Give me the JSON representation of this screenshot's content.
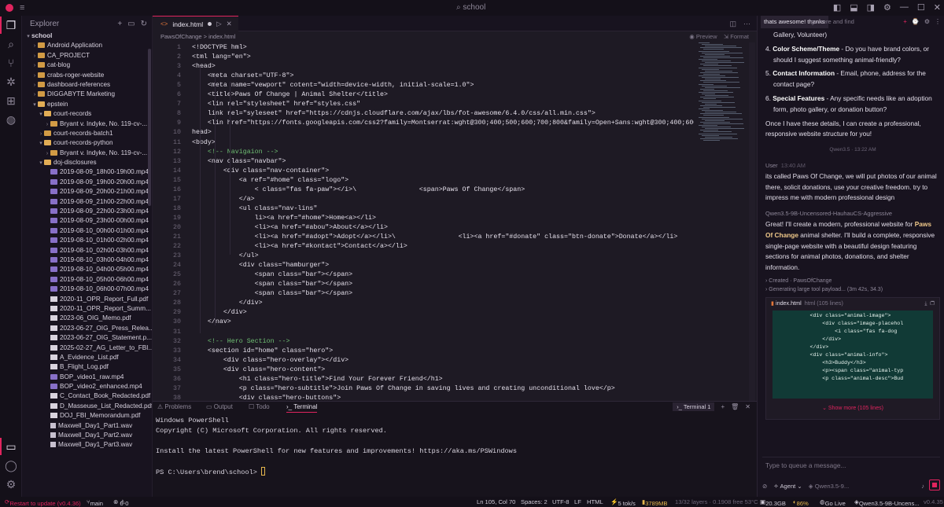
{
  "titlebar": {
    "search": "school"
  },
  "explorer": {
    "title": "Explorer",
    "root": "school",
    "items": [
      {
        "label": "Android Application",
        "kind": "folder",
        "depth": 1
      },
      {
        "label": "CA_PROJECT",
        "kind": "folder",
        "depth": 1
      },
      {
        "label": "cat-blog",
        "kind": "folder",
        "depth": 1
      },
      {
        "label": "crabs-roger-website",
        "kind": "folder",
        "depth": 1
      },
      {
        "label": "dashboard-references",
        "kind": "folder",
        "depth": 1
      },
      {
        "label": "DIGGABYTE Marketing",
        "kind": "folder",
        "depth": 1
      },
      {
        "label": "epstein",
        "kind": "folder-open",
        "depth": 1
      },
      {
        "label": "court-records",
        "kind": "folder-open",
        "depth": 2
      },
      {
        "label": "Bryant v. Indyke, No. 119-cv-...",
        "kind": "folder",
        "depth": 3
      },
      {
        "label": "court-records-batch1",
        "kind": "folder",
        "depth": 2
      },
      {
        "label": "court-records-python",
        "kind": "folder-open",
        "depth": 2
      },
      {
        "label": "Bryant v. Indyke, No. 119-cv-...",
        "kind": "folder",
        "depth": 3
      },
      {
        "label": "doj-disclosures",
        "kind": "folder-open",
        "depth": 2
      },
      {
        "label": "2019-08-09_18h00-19h00.mp4",
        "kind": "video",
        "depth": 3
      },
      {
        "label": "2019-08-09_19h00-20h00.mp4",
        "kind": "video",
        "depth": 3
      },
      {
        "label": "2019-08-09_20h00-21h00.mp4",
        "kind": "video",
        "depth": 3
      },
      {
        "label": "2019-08-09_21h00-22h00.mp4",
        "kind": "video",
        "depth": 3
      },
      {
        "label": "2019-08-09_22h00-23h00.mp4",
        "kind": "video",
        "depth": 3
      },
      {
        "label": "2019-08-09_23h00-00h00.mp4",
        "kind": "video",
        "depth": 3
      },
      {
        "label": "2019-08-10_00h00-01h00.mp4",
        "kind": "video",
        "depth": 3
      },
      {
        "label": "2019-08-10_01h00-02h00.mp4",
        "kind": "video",
        "depth": 3
      },
      {
        "label": "2019-08-10_02h00-03h00.mp4",
        "kind": "video",
        "depth": 3
      },
      {
        "label": "2019-08-10_03h00-04h00.mp4",
        "kind": "video",
        "depth": 3
      },
      {
        "label": "2019-08-10_04h00-05h00.mp4",
        "kind": "video",
        "depth": 3
      },
      {
        "label": "2019-08-10_05h00-06h00.mp4",
        "kind": "video",
        "depth": 3
      },
      {
        "label": "2019-08-10_06h00-07h00.mp4",
        "kind": "video",
        "depth": 3
      },
      {
        "label": "2020-11_OPR_Report_Full.pdf",
        "kind": "pdf",
        "depth": 3
      },
      {
        "label": "2020-11_OPR_Report_Summ...",
        "kind": "pdf",
        "depth": 3
      },
      {
        "label": "2023-06_OIG_Memo.pdf",
        "kind": "pdf",
        "depth": 3
      },
      {
        "label": "2023-06-27_OIG_Press_Relea...",
        "kind": "pdf",
        "depth": 3
      },
      {
        "label": "2023-06-27_OIG_Statement.p...",
        "kind": "pdf",
        "depth": 3
      },
      {
        "label": "2025-02-27_AG_Letter_to_FBI...",
        "kind": "pdf",
        "depth": 3
      },
      {
        "label": "A_Evidence_List.pdf",
        "kind": "pdf",
        "depth": 3
      },
      {
        "label": "B_Flight_Log.pdf",
        "kind": "pdf",
        "depth": 3
      },
      {
        "label": "BOP_video1_raw.mp4",
        "kind": "video",
        "depth": 3
      },
      {
        "label": "BOP_video2_enhanced.mp4",
        "kind": "video",
        "depth": 3
      },
      {
        "label": "C_Contact_Book_Redacted.pdf",
        "kind": "pdf",
        "depth": 3
      },
      {
        "label": "D_Masseuse_List_Redacted.pdf",
        "kind": "pdf",
        "depth": 3
      },
      {
        "label": "DOJ_FBI_Memorandum.pdf",
        "kind": "pdf",
        "depth": 3
      },
      {
        "label": "Maxwell_Day1_Part1.wav",
        "kind": "audio",
        "depth": 3
      },
      {
        "label": "Maxwell_Day1_Part2.wav",
        "kind": "audio",
        "depth": 3
      },
      {
        "label": "Maxwell_Day1_Part3.wav",
        "kind": "audio",
        "depth": 3
      }
    ]
  },
  "editor": {
    "tab_label": "index.html",
    "breadcrumb": "PawsOfChange  >  index.html",
    "preview_label": "Preview",
    "format_label": "Format",
    "lines": [
      "<!DOCTYPE hml>",
      "<tml lang=\"en\">",
      "<head>",
      "    <meta charset=\"UTF-8\">",
      "    <meta name=\"vewport\" cotent=\"width=device-width, initial-scale=1.0\">",
      "    <title>Paws Of Change | Animal Shelter</title>",
      "    <lin rel=\"stylesheet\" href=\"styles.css\"",
      "    link rel=\"syleseet\" href=\"https://cdnjs.cloudflare.com/ajax/lbs/fot-awesome/6.4.0/css/all.min.css\">",
      "    <lin href=\"https://fonts.googleapis.com/css2?family=Montserrat:wght@300;400;500;600;700;800&family=Open+Sans:wght@300;400;600&di",
      "head>",
      "<body>",
      "    <!-- Navigaion -->",
      "    <nav class=\"navbar\">",
      "        <div class=\"nav-container\">",
      "            <a ref=\"#home\" class=\"logo\">",
      "                < class=\"fas fa-paw\"></i>\\                <span>Paws Of Change</span>",
      "            </a>",
      "            <ul class=\"nav-lins\"",
      "                li><a href=\"#home\">Home<a></li>",
      "                <li><a href=\"#abou\">About</a></li>",
      "                <li><a href=\"#adopt\">Adopt</a></li>\\                <li><a href=\"#donate\" class=\"btn-donate\">Donate</a></li>",
      "                <li><a href=\"#kontact\">Contact</a></li>",
      "            </ul>",
      "            <div class=\"hamburger\">",
      "                <span class=\"bar\"></span>",
      "                <span class=\"bar\"></span>",
      "                <span class=\"bar\"></span>",
      "            </div>",
      "        </div>",
      "    </nav>",
      "",
      "    <!-- Hero Section -->",
      "    <section id=\"home\" class=\"hero\">",
      "        <div class=\"hero-overlay\"></div>",
      "        <div class=\"hero-content\">",
      "            <h1 class=\"hero-title\">Find Your Forever Friend</h1>",
      "            <p class=\"hero-subtitle\">Join Paws Of Change in saving lives and creating unconditional love</p>",
      "            <div class=\"hero-buttons\">"
    ]
  },
  "panel": {
    "tabs": [
      "Problems",
      "Output",
      "Todo",
      "Terminal"
    ],
    "active_tab": "Terminal",
    "terminal_instance": "Terminal 1",
    "lines": [
      "Windows PowerShell",
      "Copyright (C) Microsoft Corporation. All rights reserved.",
      "",
      "Install the latest PowerShell for new features and improvements! https://aka.ms/PSWindows",
      "",
      "PS C:\\Users\\brend\\school> "
    ]
  },
  "chat": {
    "tab1": "thats awesome! thanks",
    "tab2": "go here and find",
    "top_frag": "Gallery, Volunteer)",
    "list": [
      {
        "num": "4.",
        "bold": "Color Scheme/Theme",
        "text": " - Do you have brand colors, or should I suggest something animal-friendly?"
      },
      {
        "num": "5.",
        "bold": "Contact Information",
        "text": " - Email, phone, address for the contact page?"
      },
      {
        "num": "6.",
        "bold": "Special Features",
        "text": " - Any specific needs like an adoption form, photo gallery, or donation button?"
      }
    ],
    "closing": "Once I have these details, I can create a professional, responsive website structure for you!",
    "meta1": "Qwen3.5 · 13:22 AM",
    "user_label": "User",
    "user_time": "13:40 AM",
    "user_msg": "its called Paws Of Change, we will put photos of our animal there, solicit donations, use your creative freedom. try to impress me with modern professional design",
    "model_name": "Qwen3.5-9B-Uncensored-HauhauCS-Aggressive",
    "reply_pre": "Great! I'll create a modern, professional website for ",
    "reply_brand": "Paws Of Change",
    "reply_post": " animal shelter. I'll build a complete, responsive single-page website with a beautiful design featuring sections for animal photos, donations, and shelter information.",
    "tool1": "Created · PawsOfChange",
    "tool2": "Generating large tool payload... (3m 42s, 34.3)",
    "file_name": "index.html",
    "file_sub": "html  (105 lines)",
    "code_lines": [
      "            <div class=\"animal-image\">",
      "                <div class=\"image-placehol",
      "                    <i class=\"fas fa-dog",
      "                </div>",
      "            </div>",
      "            <div class=\"animal-info\">",
      "                <h3>Buddy</h3>",
      "                <p><span class=\"animal-typ",
      "                <p class=\"animal-desc\">Bud"
    ],
    "show_more": "Show more (105 lines)",
    "queue_placeholder": "Type to queue a message...",
    "mode": "Agent",
    "model_short": "Qwen3.5-9..."
  },
  "status": {
    "restart": "Restart to update (v0.4.36)",
    "branch": "main",
    "errors": "0",
    "warnings": "0",
    "position": "Ln 105, Col 70",
    "spaces": "Spaces: 2",
    "encoding": "UTF-8",
    "eol": "LF",
    "language": "HTML",
    "speed": "5 tok/s",
    "mem": "3789MB",
    "extra": "13/32 layers · 0.1908 free 53°C",
    "gpu": "20.3GB",
    "cpu": "86%",
    "golive": "Go Live",
    "model": "Qwen3.5-9B-Uncens...",
    "version": "v0.4.35"
  },
  "colors": {
    "accent": "#e0245e",
    "bg": "#18131f",
    "editor_bg": "#1e1a24",
    "warn": "#e5b64d"
  }
}
